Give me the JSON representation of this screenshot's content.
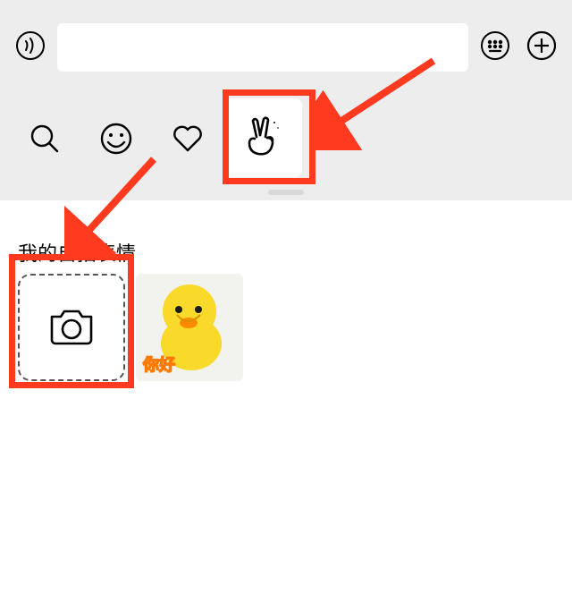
{
  "colors": {
    "annotation": "#ff3a1f",
    "panel_bg": "#ededed",
    "sticker_body": "#f9d92a",
    "sticker_caption_fill": "#ffd84a",
    "sticker_caption_stroke": "#ff7a00"
  },
  "top_bar": {
    "audio_icon": "audio-icon",
    "input_value": "",
    "keyboard_icon": "keyboard-icon",
    "plus_icon": "plus-icon"
  },
  "tabs": {
    "search_icon": "search-icon",
    "emoji_icon": "emoji-icon",
    "heart_icon": "heart-icon",
    "selfie_icon": "peace-hand-icon"
  },
  "selfie_panel": {
    "title": "我的自拍表情",
    "add_icon": "camera-icon",
    "stickers": [
      {
        "caption": "你好",
        "desc": "yellow-duck"
      }
    ]
  }
}
